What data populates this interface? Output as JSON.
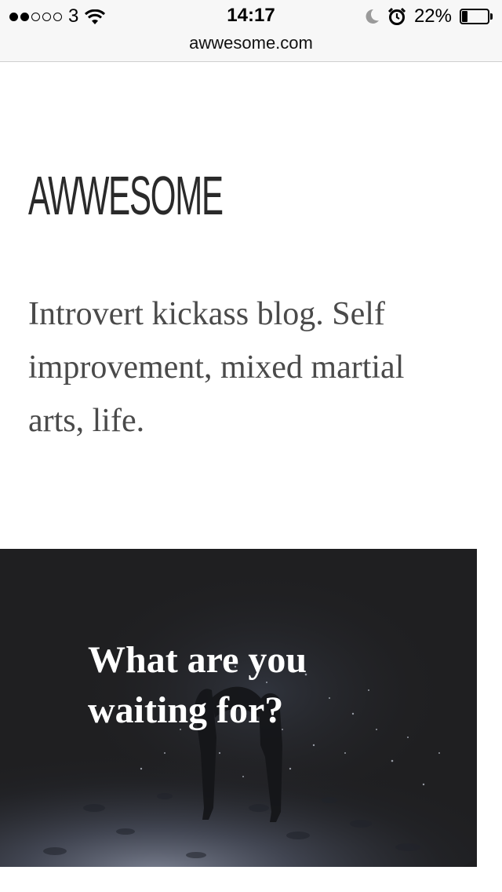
{
  "status_bar": {
    "signal_dots_filled": 2,
    "signal_dots_total": 5,
    "carrier": "3",
    "time": "14:17",
    "battery_percent": "22%",
    "battery_level": 0.22,
    "icons": [
      "wifi-icon",
      "moon-icon",
      "alarm-icon",
      "battery-icon"
    ]
  },
  "url_bar": {
    "url": "awwesome.com"
  },
  "site": {
    "logo": "AWWESOME",
    "tagline": "Introvert kickass blog. Self improvement, mixed martial arts, life."
  },
  "hero": {
    "title": "What are you waiting for?",
    "background_color": "#1f1f21"
  }
}
